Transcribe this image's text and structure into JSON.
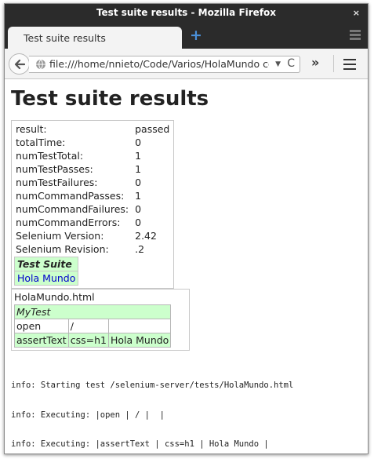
{
  "window": {
    "title": "Test suite results - Mozilla Firefox",
    "close_label": "×"
  },
  "tabs": {
    "active_label": "Test suite results",
    "new_tab_label": "+"
  },
  "navbar": {
    "url": "file:///home/nnieto/Code/Varios/HolaMundo con",
    "overflow_label": "»",
    "url_dropdown": "▼",
    "reload": "C"
  },
  "page": {
    "heading": "Test suite results",
    "summary": [
      {
        "label": "result:",
        "value": "passed"
      },
      {
        "label": "totalTime:",
        "value": "0"
      },
      {
        "label": "numTestTotal:",
        "value": "1"
      },
      {
        "label": "numTestPasses:",
        "value": "1"
      },
      {
        "label": "numTestFailures:",
        "value": "0"
      },
      {
        "label": "numCommandPasses:",
        "value": "1"
      },
      {
        "label": "numCommandFailures:",
        "value": "0"
      },
      {
        "label": "numCommandErrors:",
        "value": "0"
      },
      {
        "label": "Selenium Version:",
        "value": "2.42"
      },
      {
        "label": "Selenium Revision:",
        "value": ".2"
      }
    ],
    "suite": {
      "header": "Test Suite",
      "link": "Hola Mundo"
    },
    "test": {
      "filename": "HolaMundo.html",
      "title": "MyTest",
      "rows": [
        {
          "command": "open",
          "target": "/",
          "value": ""
        },
        {
          "command": "assertText",
          "target": "css=h1",
          "value": "Hola Mundo"
        }
      ]
    },
    "log": [
      "info: Starting test /selenium-server/tests/HolaMundo.html",
      "info: Executing: |open | / |  |",
      "info: Executing: |assertText | css=h1 | Hola Mundo |"
    ]
  }
}
